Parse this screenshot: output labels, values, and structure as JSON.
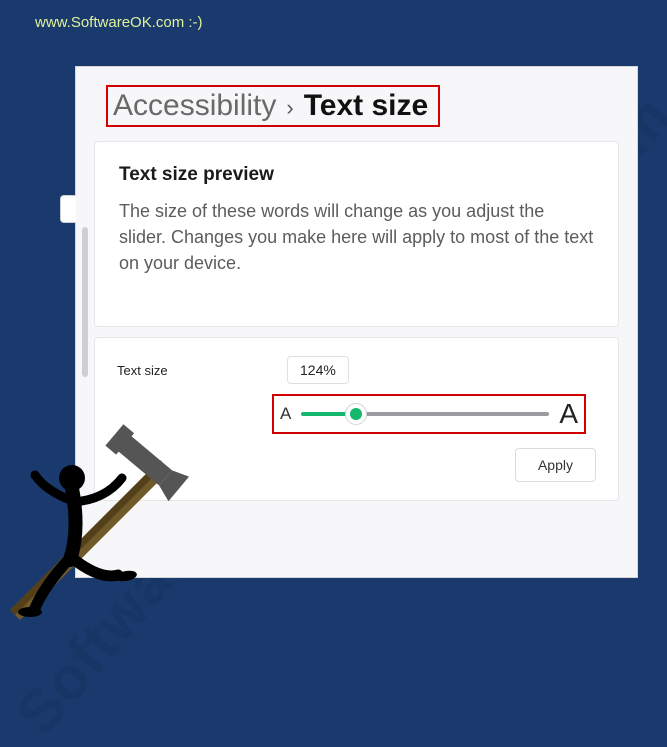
{
  "watermark_top": "www.SoftwareOK.com :-)",
  "watermark_diag": "SoftwareOK.com",
  "breadcrumb": {
    "parent": "Accessibility",
    "separator": "›",
    "current": "Text size"
  },
  "preview": {
    "title": "Text size preview",
    "body": "The size of these words will change as you adjust the slider. Changes you make here will apply to most of the text on your device."
  },
  "slider": {
    "label": "Text size",
    "value_pct": "124%",
    "small_a": "A",
    "big_a": "A",
    "apply_label": "Apply"
  }
}
